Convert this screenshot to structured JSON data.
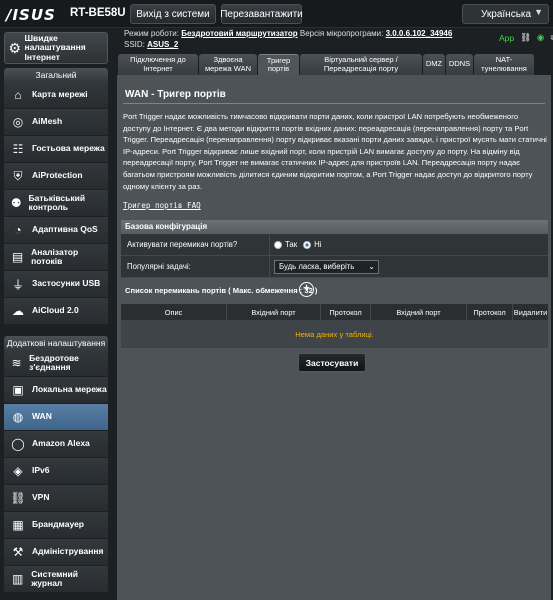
{
  "header": {
    "brand": "/ISUS",
    "model": "RT-BE58U",
    "logout": "Вихід з системи",
    "reboot": "Перезавантажити",
    "language": "Українська"
  },
  "info": {
    "mode_label": "Режим роботи:",
    "mode_value": "Бездротовий маршрутизатор",
    "fw_label": "Версія мікропрограми:",
    "fw_value": "3.0.0.6.102_34946",
    "ssid_label": "SSID:",
    "ssid_value": "ASUS_2",
    "app_label": "App"
  },
  "sidebar": {
    "quick": "Швидке налаштування Інтернет",
    "general_title": "Загальний",
    "general": [
      {
        "label": "Карта мережі",
        "icon": "network-map-icon"
      },
      {
        "label": "AiMesh",
        "icon": "aimesh-icon"
      },
      {
        "label": "Гостьова мережа",
        "icon": "guest-network-icon"
      },
      {
        "label": "AiProtection",
        "icon": "shield-icon"
      },
      {
        "label": "Батьківський контроль",
        "icon": "parental-control-icon"
      },
      {
        "label": "Адаптивна QoS",
        "icon": "qos-icon"
      },
      {
        "label": "Аналізатор потоків",
        "icon": "traffic-analyzer-icon"
      },
      {
        "label": "Застосунки USB",
        "icon": "usb-icon"
      },
      {
        "label": "AiCloud 2.0",
        "icon": "cloud-icon"
      }
    ],
    "advanced_title": "Додаткові налаштування",
    "advanced": [
      {
        "label": "Бездротове з'єднання",
        "icon": "wireless-icon"
      },
      {
        "label": "Локальна мережа",
        "icon": "lan-icon"
      },
      {
        "label": "WAN",
        "icon": "globe-icon"
      },
      {
        "label": "Amazon Alexa",
        "icon": "alexa-icon"
      },
      {
        "label": "IPv6",
        "icon": "ipv6-icon"
      },
      {
        "label": "VPN",
        "icon": "vpn-icon"
      },
      {
        "label": "Брандмауер",
        "icon": "firewall-icon"
      },
      {
        "label": "Адміністрування",
        "icon": "admin-icon"
      },
      {
        "label": "Системний журнал",
        "icon": "system-log-icon"
      }
    ],
    "active_index": 2
  },
  "tabs": [
    "Підключення до Інтернет",
    "Здвоєна мережа WAN",
    "Тригер портів",
    "Віртуальний сервер / Переадресація порту",
    "DMZ",
    "DDNS",
    "NAT-тунелювання"
  ],
  "page": {
    "title": "WAN - Тригер портів",
    "description": "Port Trigger надає можливість тимчасово відкривати порти даних, коли пристрої LAN потребують необмеженого доступу до Інтернет. Є два методи відкриття портів вхідних даних: переадресація (перенаправлення) порту та Port Trigger. Переадресація (перенаправлення) порту відкриває вказані порти даних завжди, і пристрої мусять мати статичні IP-адреси. Port Trigger відкриває лише вхідний порт, коли пристрій LAN вимагає доступу до порту. На відміну від переадресації порту, Port Trigger не вимагає статичних IP-адрес для пристроїв LAN. Переадресація порту надає багатьом пристроям можливість ділитися єдиним відкритим портом, а Port Trigger надає доступ до відкритого порту одному клієнту за раз.",
    "faq": "Тригер портів FAQ",
    "config_title": "Базова конфігурація",
    "enable_label": "Активувати перемикач портів?",
    "yes": "Так",
    "no": "Ні",
    "enabled": false,
    "popular_label": "Популярні задачі:",
    "popular_value": "Будь ласка, виберіть",
    "list_title": "Список перемикань портів ( Макс. обмеження : 32 )",
    "columns": [
      "Опис",
      "Вхідний порт",
      "Протокол",
      "Вхідний порт",
      "Протокол",
      "Видалити"
    ],
    "empty": "Нема даних у таблиці.",
    "apply": "Застосувати"
  }
}
